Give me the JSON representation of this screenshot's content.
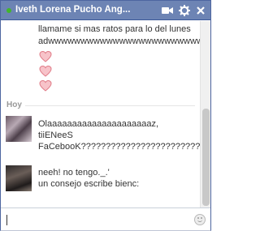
{
  "chat": {
    "title": "Iveth Lorena Pucho Ang...",
    "icons": {
      "status": "online-dot-icon",
      "video": "video-camera-icon",
      "settings": "gear-icon",
      "close": "close-icon",
      "emoji": "smiley-icon"
    }
  },
  "messages": {
    "earlier": {
      "line1": "llamame si mas ratos para lo del lunes",
      "line2": "adwwwwwwwwwwwwwwwwwwwwwwww",
      "hearts": [
        "heart",
        "heart",
        "heart"
      ]
    },
    "day_label": "Hoy",
    "group1": {
      "line1": "Olaaaaaaaaaaaaaaaaaaaaaz,",
      "line2": "tiiENeeS",
      "line3": "FaCebooK???????????????????????????"
    },
    "group2": {
      "line1": "neeh! no tengo._.'",
      "line2": "un consejo escribe bienc:"
    }
  },
  "input": {
    "value": "",
    "placeholder": ""
  },
  "colors": {
    "title_bar": "#6d84b4",
    "heart": "#e07a86"
  }
}
